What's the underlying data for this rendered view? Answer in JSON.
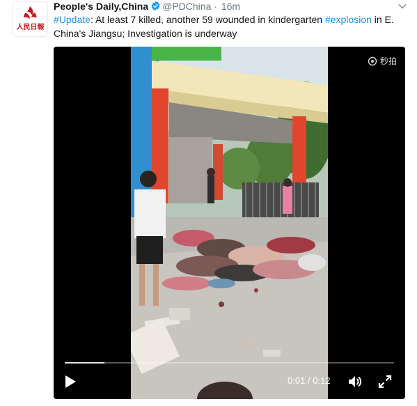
{
  "tweet": {
    "author": {
      "name": "People's Daily,China",
      "handle": "@PDChina",
      "separator": "·",
      "time": "16m",
      "avatar_text": "人民日報"
    },
    "text_parts": [
      {
        "text": "#Update",
        "hashtag": true
      },
      {
        "text": ": At least 7 killed, another 59 wounded in kindergarten ",
        "hashtag": false
      },
      {
        "text": "#explosion",
        "hashtag": true
      },
      {
        "text": " in E. China's Jiangsu; Investigation is underway",
        "hashtag": false
      }
    ],
    "caret_icon": "chevron-down-icon"
  },
  "video": {
    "watermark": "秒拍",
    "current_time": "0:01",
    "time_separator": "/",
    "duration": "0:12",
    "progress": 0.12,
    "controls": [
      "play-icon",
      "volume-icon",
      "fullscreen-icon"
    ]
  },
  "colors": {
    "hashtag": "#1b95e0",
    "verified": "#1da1f2",
    "muted_text": "#657786",
    "avatar_red": "#c8161d"
  }
}
